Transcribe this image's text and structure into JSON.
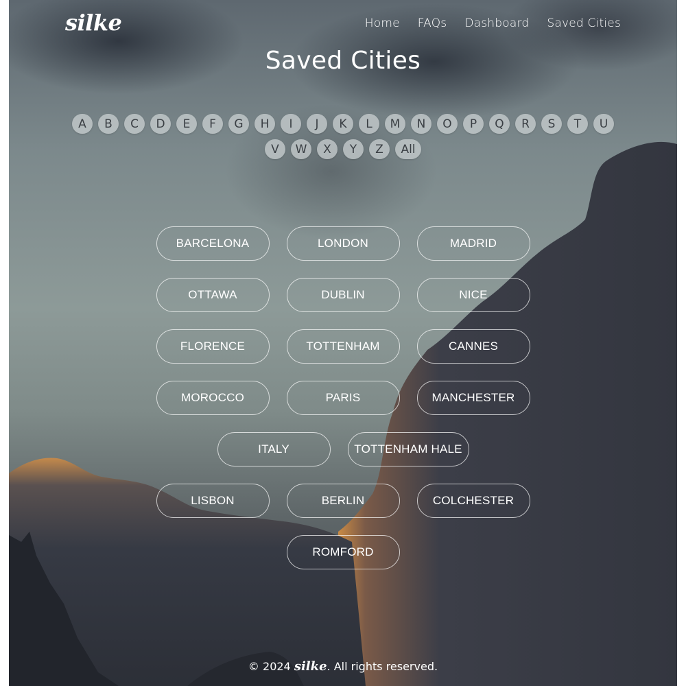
{
  "brand": {
    "logo_text": "silke"
  },
  "nav": {
    "items": [
      {
        "label": "Home"
      },
      {
        "label": "FAQs"
      },
      {
        "label": "Dashboard"
      },
      {
        "label": "Saved Cities"
      }
    ]
  },
  "page_title": "Saved Cities",
  "alphabet_filter": {
    "letters": [
      "A",
      "B",
      "C",
      "D",
      "E",
      "F",
      "G",
      "H",
      "I",
      "J",
      "K",
      "L",
      "M",
      "N",
      "O",
      "P",
      "Q",
      "R",
      "S",
      "T",
      "U",
      "V",
      "W",
      "X",
      "Y",
      "Z"
    ],
    "all_label": "All"
  },
  "cities": [
    "BARCELONA",
    "LONDON",
    "MADRID",
    "OTTAWA",
    "DUBLIN",
    "NICE",
    "FLORENCE",
    "TOTTENHAM",
    "CANNES",
    "MOROCCO",
    "PARIS",
    "MANCHESTER",
    "ITALY",
    "TOTTENHAM HALE",
    "LISBON",
    "BERLIN",
    "COLCHESTER",
    "ROMFORD"
  ],
  "footer": {
    "prefix": "© 2024",
    "brand": "silke",
    "suffix": ". All rights reserved."
  },
  "colors": {
    "text": "#ffffff",
    "letter_bg": "#cdd2d4",
    "letter_text": "#3a3f44",
    "city_border": "#ffffff"
  }
}
